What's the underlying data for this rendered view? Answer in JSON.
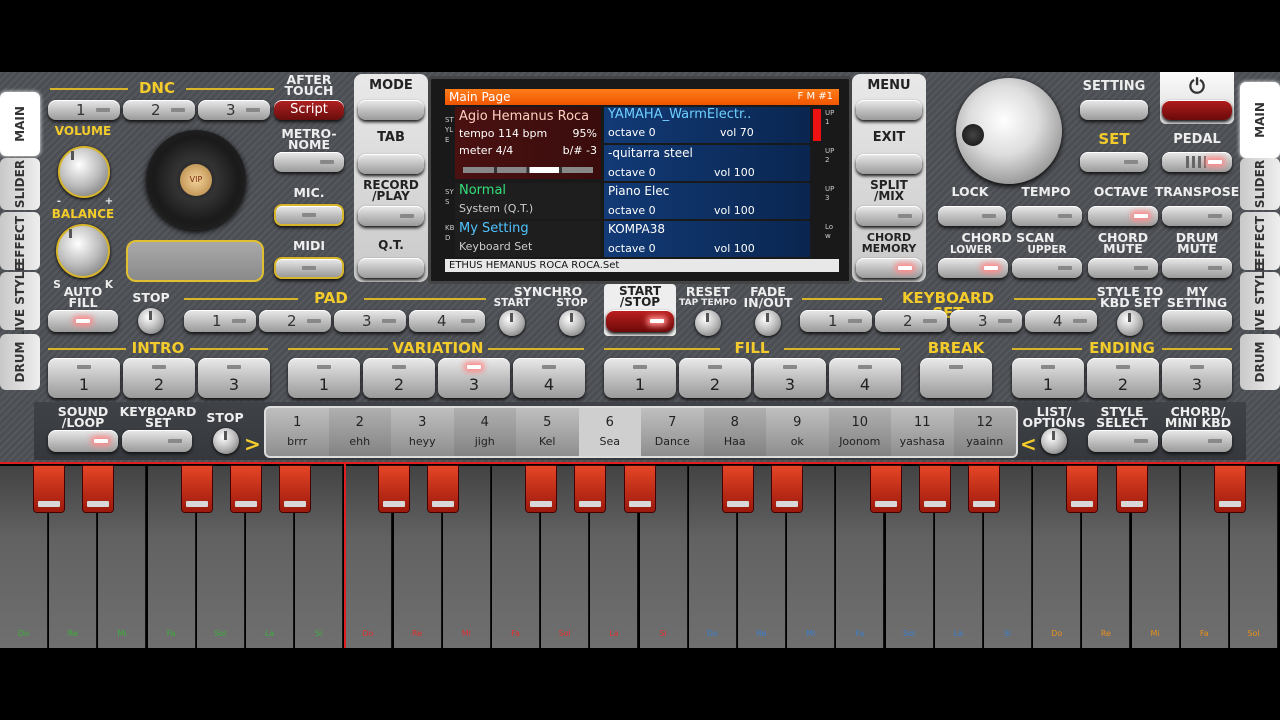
{
  "tabs": {
    "main": "MAIN",
    "slider": "SLIDER",
    "effect": "EFFECT",
    "live_style": "LIVE\nSTYLE",
    "drum": "DRUM"
  },
  "top": {
    "dnc": "DNC",
    "after_touch": "AFTER\nTOUCH",
    "script": "Script",
    "volume": "VOLUME",
    "balance": "BALANCE",
    "bal_minus": "-",
    "bal_plus": "+",
    "bal_s": "S",
    "bal_k": "K",
    "metronome": "METRO-\nNOME",
    "mic": "MIC.",
    "midi": "MIDI",
    "dnc_buttons": [
      "1",
      "2",
      "3"
    ],
    "logo": "VIP"
  },
  "nav": {
    "mode": "MODE",
    "tab": "TAB",
    "record_play": "RECORD\n/PLAY",
    "qt": "Q.T.",
    "menu": "MENU",
    "exit": "EXIT",
    "split_mix": "SPLIT\n/MIX",
    "chord_memory": "CHORD\nMEMORY"
  },
  "screen": {
    "title": "Main Page",
    "fm": "F M #1",
    "side_style": "STYLE",
    "side_sys": "SYS",
    "side_kbd": "KBD",
    "style_name": "Agio Hemanus Roca",
    "tempo": "tempo 114 bpm",
    "pct": "95%",
    "meter": "meter 4/4",
    "bsharp": "b/# -3",
    "up1_name": "YAMAHA_WarmElectr..",
    "up1_oct": "octave 0",
    "up1_vol": "vol 70",
    "up2_name": "-quitarra steel",
    "up2_oct": "octave 0",
    "up2_vol": "vol 100",
    "sys_name": "Normal",
    "sys_sub": "System (Q.T.)",
    "up3_name": "Piano Elec",
    "up3_oct": "octave 0",
    "up3_vol": "vol 100",
    "kbd_name": "My Setting",
    "kbd_sub": "Keyboard Set",
    "low_name": "KOMPA38",
    "low_oct": "octave 0",
    "low_vol": "vol 100",
    "r_up1": "UP1",
    "r_up2": "UP2",
    "r_up3": "UP3",
    "r_low": "Low",
    "footer": "ETHUS HEMANUS ROCA ROCA.Set"
  },
  "right": {
    "setting": "SETTING",
    "set": "SET",
    "pedal": "PEDAL",
    "power": "⏻",
    "lock": "LOCK",
    "tempo": "TEMPO",
    "octave": "OCTAVE",
    "transpose": "TRANSPOSE",
    "chord_scan": "CHORD SCAN",
    "lower": "LOWER",
    "upper": "UPPER",
    "chord_mute": "CHORD\nMUTE",
    "drum_mute": "DRUM\nMUTE"
  },
  "row3": {
    "auto_fill": "AUTO\nFILL",
    "stop": "STOP",
    "pad": "PAD",
    "pad_buttons": [
      "1",
      "2",
      "3",
      "4"
    ],
    "synchro": "SYNCHRO",
    "start": "START",
    "stop2": "STOP",
    "start_stop": "START\n/STOP",
    "reset": "RESET",
    "tap_tempo": "TAP TEMPO",
    "fade": "FADE\nIN/OUT",
    "keyboard_set": "KEYBOARD SET",
    "kbd_buttons": [
      "1",
      "2",
      "3",
      "4"
    ],
    "style_to_kbd": "STYLE TO\nKBD SET",
    "my_setting": "MY\nSETTING"
  },
  "row4": {
    "intro": "INTRO",
    "intro_buttons": [
      "1",
      "2",
      "3"
    ],
    "variation": "VARIATION",
    "var_buttons": [
      "1",
      "2",
      "3",
      "4"
    ],
    "fill": "FILL",
    "fill_buttons": [
      "1",
      "2",
      "3",
      "4"
    ],
    "break": "BREAK",
    "ending": "ENDING",
    "end_buttons": [
      "1",
      "2",
      "3"
    ]
  },
  "row5": {
    "sound_loop": "SOUND\n/LOOP",
    "keyboard_set": "KEYBOARD\nSET",
    "stop": "STOP",
    "list_options": "LIST/\nOPTIONS",
    "style_select": "STYLE\nSELECT",
    "chord_mini": "CHORD/\nMINI KBD",
    "slots": [
      {
        "n": "1",
        "name": "brrr"
      },
      {
        "n": "2",
        "name": "ehh"
      },
      {
        "n": "3",
        "name": "heyy"
      },
      {
        "n": "4",
        "name": "jigh"
      },
      {
        "n": "5",
        "name": "Kel"
      },
      {
        "n": "6",
        "name": "Sea"
      },
      {
        "n": "7",
        "name": "Dance"
      },
      {
        "n": "8",
        "name": "Haa"
      },
      {
        "n": "9",
        "name": "ok"
      },
      {
        "n": "10",
        "name": "Joonom"
      },
      {
        "n": "11",
        "name": "yashasa"
      },
      {
        "n": "12",
        "name": "yaainn"
      }
    ]
  },
  "keyboard": {
    "notes": [
      "Do",
      "Re",
      "Mi",
      "Fa",
      "Sol",
      "La",
      "Si",
      "Do",
      "Re",
      "Mi",
      "Fa",
      "Sol",
      "La",
      "Si",
      "Do",
      "Re",
      "Mi",
      "Fa",
      "Sol",
      "La",
      "Si",
      "Do",
      "Re",
      "Mi",
      "Fa",
      "Sol"
    ],
    "octave_colors": [
      "#3bb03b",
      "#e03030",
      "#3a7fd0",
      "#e8901a"
    ]
  }
}
